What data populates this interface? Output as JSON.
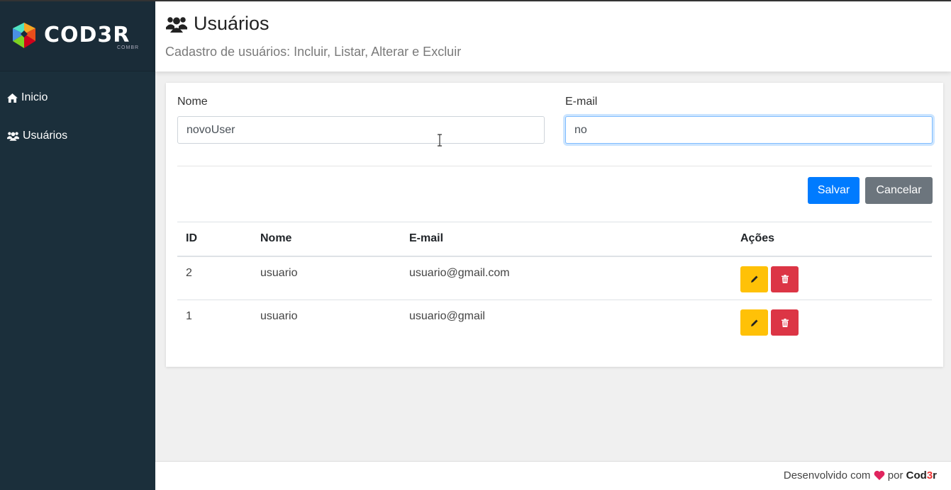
{
  "logo": {
    "text": "COD3R",
    "subtext": "COMBR"
  },
  "sidebar": {
    "items": [
      {
        "label": "Inicio",
        "icon": "home-icon"
      },
      {
        "label": "Usuários",
        "icon": "users-icon"
      }
    ]
  },
  "header": {
    "title": "Usuários",
    "subtitle": "Cadastro de usuários: Incluir, Listar, Alterar e Excluir"
  },
  "form": {
    "name_label": "Nome",
    "name_value": "novoUser",
    "email_label": "E-mail",
    "email_value": "no",
    "save_label": "Salvar",
    "cancel_label": "Cancelar"
  },
  "table": {
    "headers": [
      "ID",
      "Nome",
      "E-mail",
      "Ações"
    ],
    "rows": [
      {
        "id": "2",
        "name": "usuario",
        "email": "usuario@gmail.com"
      },
      {
        "id": "1",
        "name": "usuario",
        "email": "usuario@gmail"
      }
    ]
  },
  "footer": {
    "prefix": "Desenvolvido com",
    "by": "por",
    "brand_a": "Cod",
    "brand_b": "3",
    "brand_c": "r"
  },
  "colors": {
    "sidebar": "#1b2f3b",
    "primary": "#007bff",
    "secondary": "#6c757d",
    "warning": "#ffc107",
    "danger": "#dc3545",
    "heart": "#e0245e"
  }
}
